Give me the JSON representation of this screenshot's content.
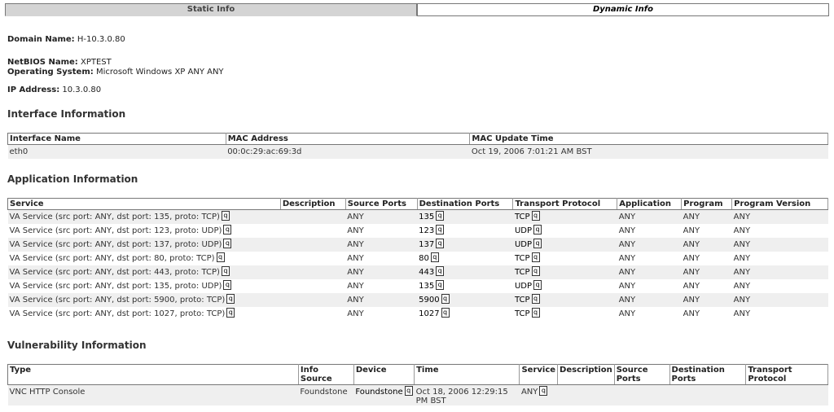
{
  "tabs": {
    "static": "Static Info",
    "dynamic": "Dynamic Info"
  },
  "host": {
    "domain_label": "Domain Name:",
    "domain": "H-10.3.0.80",
    "netbios_label": "NetBIOS Name:",
    "netbios": "XPTEST",
    "os_label": "Operating System:",
    "os": "Microsoft Windows XP ANY ANY",
    "ip_label": "IP Address:",
    "ip": "10.3.0.80"
  },
  "interface": {
    "title": "Interface Information",
    "headers": [
      "Interface Name",
      "MAC Address",
      "MAC Update Time"
    ],
    "rows": [
      [
        "eth0",
        "00:0c:29:ac:69:3d",
        "Oct 19, 2006 7:01:21 AM BST"
      ]
    ]
  },
  "application": {
    "title": "Application Information",
    "headers": [
      "Service",
      "Description",
      "Source Ports",
      "Destination Ports",
      "Transport Protocol",
      "Application",
      "Program",
      "Program Version"
    ],
    "rows": [
      {
        "service": "VA Service (src port: ANY, dst port: 135, proto: TCP)",
        "description": "",
        "source_ports": "ANY",
        "dest_ports": "135",
        "transport": "TCP",
        "application": "ANY",
        "program": "ANY",
        "version": "ANY"
      },
      {
        "service": "VA Service (src port: ANY, dst port: 123, proto: UDP)",
        "description": "",
        "source_ports": "ANY",
        "dest_ports": "123",
        "transport": "UDP",
        "application": "ANY",
        "program": "ANY",
        "version": "ANY"
      },
      {
        "service": "VA Service (src port: ANY, dst port: 137, proto: UDP)",
        "description": "",
        "source_ports": "ANY",
        "dest_ports": "137",
        "transport": "UDP",
        "application": "ANY",
        "program": "ANY",
        "version": "ANY"
      },
      {
        "service": "VA Service (src port: ANY, dst port: 80, proto: TCP)",
        "description": "",
        "source_ports": "ANY",
        "dest_ports": "80",
        "transport": "TCP",
        "application": "ANY",
        "program": "ANY",
        "version": "ANY"
      },
      {
        "service": "VA Service (src port: ANY, dst port: 443, proto: TCP)",
        "description": "",
        "source_ports": "ANY",
        "dest_ports": "443",
        "transport": "TCP",
        "application": "ANY",
        "program": "ANY",
        "version": "ANY"
      },
      {
        "service": "VA Service (src port: ANY, dst port: 135, proto: UDP)",
        "description": "",
        "source_ports": "ANY",
        "dest_ports": "135",
        "transport": "UDP",
        "application": "ANY",
        "program": "ANY",
        "version": "ANY"
      },
      {
        "service": "VA Service (src port: ANY, dst port: 5900, proto: TCP)",
        "description": "",
        "source_ports": "ANY",
        "dest_ports": "5900",
        "transport": "TCP",
        "application": "ANY",
        "program": "ANY",
        "version": "ANY"
      },
      {
        "service": "VA Service (src port: ANY, dst port: 1027, proto: TCP)",
        "description": "",
        "source_ports": "ANY",
        "dest_ports": "1027",
        "transport": "TCP",
        "application": "ANY",
        "program": "ANY",
        "version": "ANY"
      }
    ]
  },
  "vulnerability": {
    "title": "Vulnerability Information",
    "headers": [
      "Type",
      "Info Source",
      "Device",
      "Time",
      "Service",
      "Description",
      "Source Ports",
      "Destination Ports",
      "Transport Protocol"
    ],
    "rows": [
      {
        "type": "VNC HTTP Console",
        "info_source": "Foundstone",
        "device": "Foundstone",
        "time": "Oct 18, 2006 12:29:15 PM BST",
        "service": "ANY",
        "description": "",
        "source_ports": "",
        "dest_ports": "",
        "transport": ""
      }
    ]
  },
  "icon_glyph": "q",
  "colors": {
    "tab_active_bg": "#d4d4d4",
    "row_alt_bg": "#efefef",
    "border": "#777777"
  }
}
